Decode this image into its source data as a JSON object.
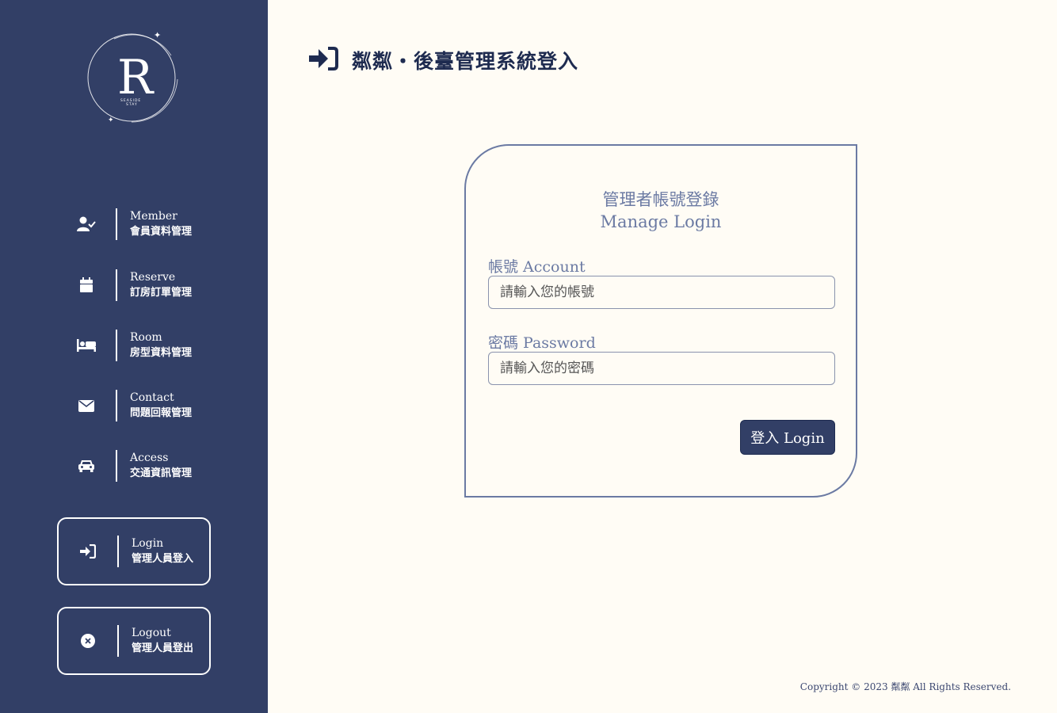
{
  "sidebar": {
    "logo_letter": "R",
    "logo_text_1": "SEASIDE",
    "logo_text_2": "STAY",
    "items": [
      {
        "en": "Member",
        "zh": "會員資料管理",
        "icon": "user-check-icon"
      },
      {
        "en": "Reserve",
        "zh": "訂房訂單管理",
        "icon": "calendar-icon"
      },
      {
        "en": "Room",
        "zh": "房型資料管理",
        "icon": "bed-icon"
      },
      {
        "en": "Contact",
        "zh": "問題回報管理",
        "icon": "envelope-icon"
      },
      {
        "en": "Access",
        "zh": "交通資訊管理",
        "icon": "car-icon"
      }
    ],
    "login": {
      "en": "Login",
      "zh": "管理人員登入",
      "icon": "sign-in-icon"
    },
    "logout": {
      "en": "Logout",
      "zh": "管理人員登出",
      "icon": "circle-x-icon"
    }
  },
  "header": {
    "title": "粼粼・後臺管理系統登入",
    "icon": "sign-in-icon"
  },
  "card": {
    "title_zh": "管理者帳號登錄",
    "title_en": "Manage Login",
    "account_label": "帳號 Account",
    "account_placeholder": "請輸入您的帳號",
    "password_label": "密碼 Password",
    "password_placeholder": "請輸入您的密碼",
    "login_button": "登入 Login"
  },
  "footer": {
    "copyright": "Copyright © 2023 粼粼 All Rights Reserved."
  },
  "colors": {
    "sidebar_bg": "#323f66",
    "page_bg": "#fffcf5",
    "accent": "#6b7aa3"
  }
}
